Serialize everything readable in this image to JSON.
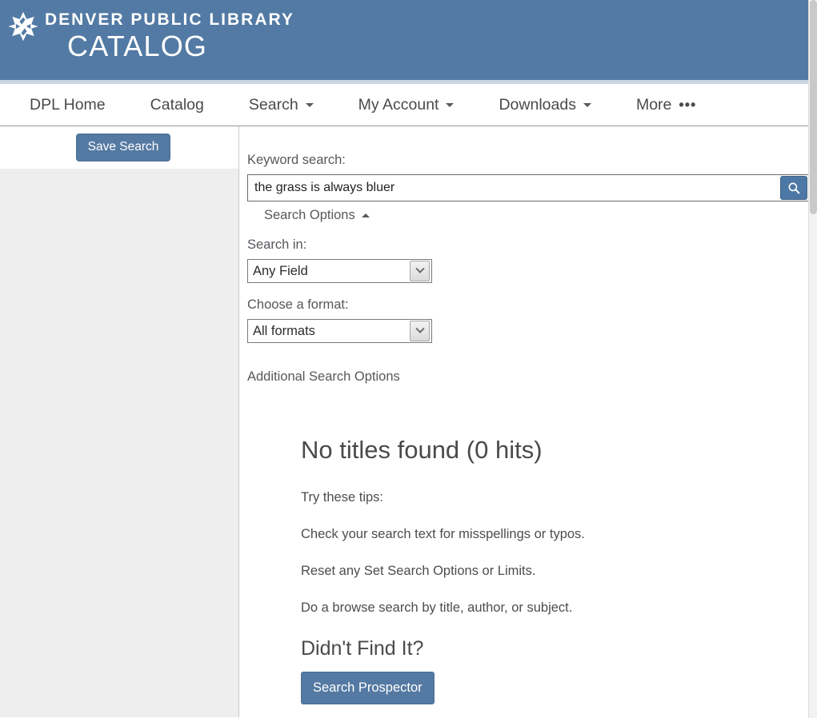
{
  "header": {
    "logo_icon": "dpl-star-logo-icon",
    "brand_line1": "DENVER PUBLIC LIBRARY",
    "brand_line2": "CATALOG",
    "bg_color": "#527aa4",
    "underline_color": "#c8d4e0"
  },
  "nav": {
    "items": [
      {
        "label": "DPL Home",
        "has_caret": false,
        "has_ellipsis": false
      },
      {
        "label": "Catalog",
        "has_caret": false,
        "has_ellipsis": false
      },
      {
        "label": "Search",
        "has_caret": true,
        "has_ellipsis": false
      },
      {
        "label": "My Account",
        "has_caret": true,
        "has_ellipsis": false
      },
      {
        "label": "Downloads",
        "has_caret": true,
        "has_ellipsis": false
      },
      {
        "label": "More",
        "has_caret": false,
        "has_ellipsis": true
      }
    ]
  },
  "sidebar": {
    "save_search_label": "Save Search",
    "bg_color": "#eeeeee"
  },
  "search_panel": {
    "keyword_label": "Keyword search:",
    "keyword_value": "the grass is always bluer",
    "keyword_placeholder": "",
    "search_button_icon": "magnifier-icon",
    "search_options_label": "Search Options",
    "search_options_state": "expanded",
    "search_in_label": "Search in:",
    "search_in_value": "Any Field",
    "format_label": "Choose a format:",
    "format_value": "All formats",
    "additional_options_label": "Additional Search Options"
  },
  "results": {
    "heading": "No titles found (0 hits)",
    "tips_intro": "Try these tips:",
    "tips": [
      "Check your search text for misspellings or typos.",
      "Reset any Set Search Options or Limits.",
      "Do a browse search by title, author, or subject."
    ],
    "didnt_find_heading": "Didn't Find It?",
    "prospector_button_label": "Search Prospector"
  },
  "theme": {
    "accent_blue": "#5479a2",
    "header_blue": "#527aa4",
    "text_gray": "#4a4a4a"
  }
}
